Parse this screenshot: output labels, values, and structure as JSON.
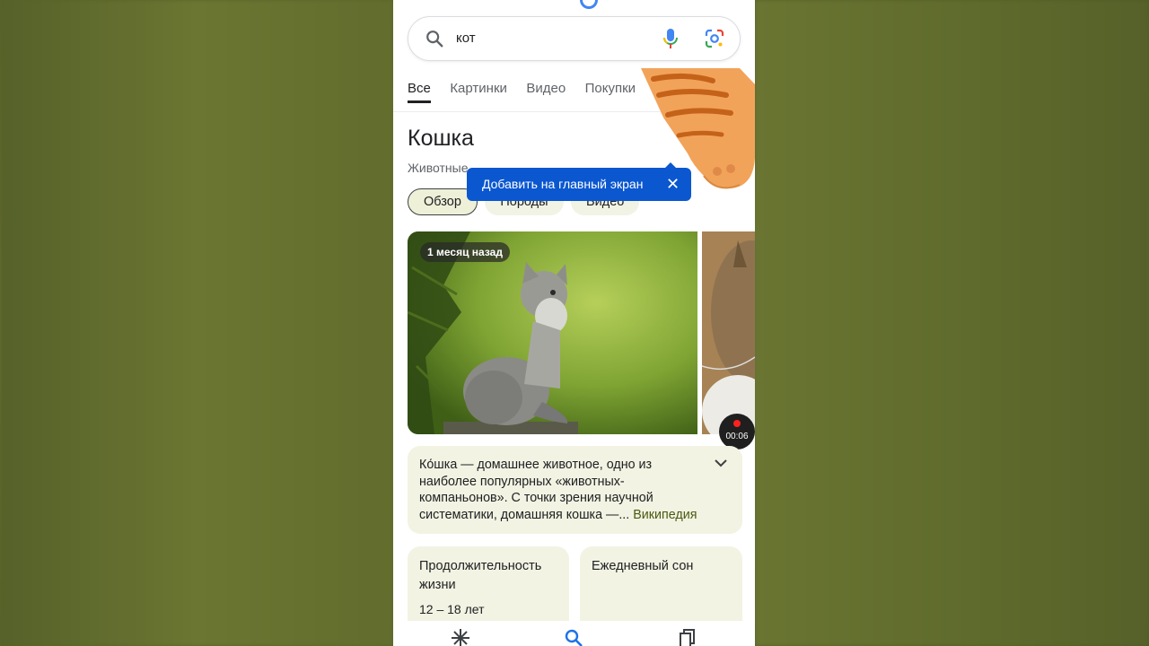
{
  "search": {
    "query": "кот"
  },
  "tabs": [
    {
      "label": "Все",
      "active": true
    },
    {
      "label": "Картинки",
      "active": false
    },
    {
      "label": "Видео",
      "active": false
    },
    {
      "label": "Покупки",
      "active": false
    }
  ],
  "knowledge_panel": {
    "title": "Кошка",
    "subtitle": "Животные",
    "chips": [
      {
        "label": "Обзор",
        "active": true
      },
      {
        "label": "Породы",
        "active": false
      },
      {
        "label": "Видео",
        "active": false
      }
    ],
    "image_badge": "1 месяц назад",
    "description": "Ко́шка — домашнее животное, одно из наиболее популярных «животных-компаньонов». С точки зрения научной систематики, домашняя кошка —... ",
    "description_link": "Википедия",
    "facts": [
      {
        "label": "Продолжительность жизни",
        "value": "12 – 18 лет"
      },
      {
        "label": "Ежедневный сон",
        "value": ""
      }
    ]
  },
  "tooltip": {
    "text": "Добавить на главный экран"
  },
  "recording": {
    "time": "00:06"
  },
  "colors": {
    "accent_blue": "#0b57d0",
    "card_bg": "#f2f3e2",
    "link_green": "#4a5a12",
    "backdrop_olive": "#6b7632"
  },
  "icons": [
    "search-icon",
    "mic-icon",
    "lens-icon",
    "close-icon",
    "chevron-down-icon",
    "discover-icon",
    "search-nav-icon",
    "tabs-icon"
  ]
}
